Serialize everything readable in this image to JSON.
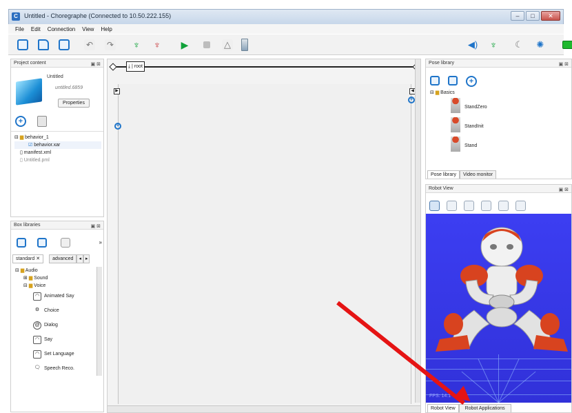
{
  "window": {
    "title": "Untitled - Choregraphe (Connected to 10.50.222.155)",
    "app_icon": "C",
    "buttons": [
      "–",
      "□",
      "✕"
    ]
  },
  "menu": [
    "File",
    "Edit",
    "Connection",
    "View",
    "Help"
  ],
  "project": {
    "header": "Project content",
    "name": "Untitled",
    "file": "untitled.6859",
    "properties_label": "Properties",
    "tree": [
      "behavior_1",
      "behavior.xar",
      "manifest.xml",
      "Untitled.pml"
    ]
  },
  "box_libraries": {
    "header": "Box libraries",
    "tabs": [
      "standard",
      "advanced"
    ],
    "tree": [
      {
        "label": "Audio",
        "type": "folder"
      },
      {
        "label": "Sound",
        "type": "folder"
      },
      {
        "label": "Voice",
        "type": "folder"
      }
    ],
    "boxes": [
      "Animated Say",
      "Choice",
      "Dialog",
      "Say",
      "Set Language",
      "Speech Reco."
    ]
  },
  "canvas": {
    "root_label": "root"
  },
  "pose_library": {
    "header": "Pose library",
    "folder": "Basics",
    "poses": [
      "StandZero",
      "StandInit",
      "Stand"
    ],
    "tabs": [
      "Pose library",
      "Video monitor"
    ]
  },
  "robot_view": {
    "header": "Robot View",
    "fps_text": "FPS: 14.1",
    "tabs": [
      "Robot View",
      "Robot Applications"
    ]
  },
  "colors": {
    "accent": "#1e74c9",
    "annotation_arrow": "#e51414",
    "viewport": "#3636e6"
  }
}
